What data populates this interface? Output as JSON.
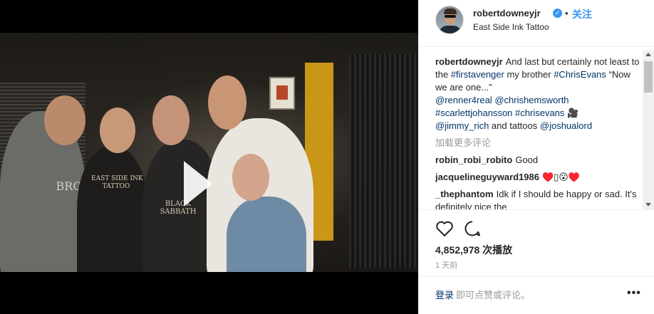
{
  "post": {
    "username": "robertdowneyjr",
    "follow_label": "关注",
    "separator": "•",
    "location": "East Side Ink Tattoo",
    "caption": {
      "text1": "And last but certainly not least to the ",
      "tag1": "#firstavenger",
      "text2": " my brother ",
      "tag2": "#ChrisEvans",
      "text3": " “Now we are one...” ",
      "mention1": "@renner4real",
      "mention2": "@chrishemsworth",
      "tag3": "#scarlettjohansson",
      "tag4": "#chrisevans",
      "emoji": "🎥",
      "mention3": "@jimmy_rich",
      "text4": " and tattoos ",
      "mention4": "@joshualord"
    },
    "load_more": "加载更多评论",
    "comments": [
      {
        "user": "robin_robi_robito",
        "text": "Good"
      },
      {
        "user": "jacquelineguyward1986",
        "text": "♥️▯😮♥️"
      },
      {
        "user": "_thephantom",
        "text": "Idk if I should be happy or sad. It's definitely nice the"
      }
    ],
    "views": "4,852,978 次播放",
    "time": "1 天前",
    "login_label": "登录",
    "login_suffix": " 即可点赞或评论。",
    "more_label": "•••"
  },
  "video": {
    "shirt_text_1": "EAST SIDE INK\nTATTOO",
    "shirt_text_2": "BLACK\nSABBATH",
    "shirt_text_3": "BRO"
  }
}
